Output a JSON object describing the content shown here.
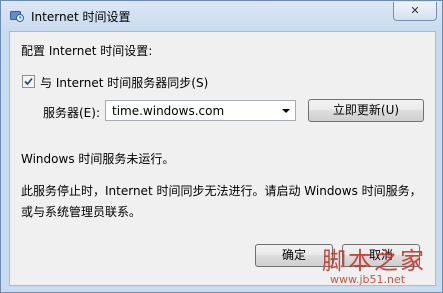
{
  "window": {
    "title": "Internet 时间设置",
    "close_label": "✕"
  },
  "section": {
    "heading": "配置 Internet 时间设置:"
  },
  "sync": {
    "label": "与 Internet 时间服务器同步(S)",
    "checked": true
  },
  "server": {
    "label": "服务器(E):",
    "value": "time.windows.com",
    "update_button": "立即更新(U)"
  },
  "status": {
    "line1": "Windows 时间服务未运行。",
    "line2": "此服务停止时，Internet 时间同步无法进行。请启动 Windows 时间服务，",
    "line3": "或与系统管理员联系。"
  },
  "buttons": {
    "ok": "确定",
    "cancel": "取消"
  },
  "watermark": {
    "text": "脚本之家",
    "url": "www.jb51.net"
  },
  "colors": {
    "accent": "#c9dbef",
    "client_bg": "#f0f0f0",
    "watermark": "#c0392b"
  }
}
